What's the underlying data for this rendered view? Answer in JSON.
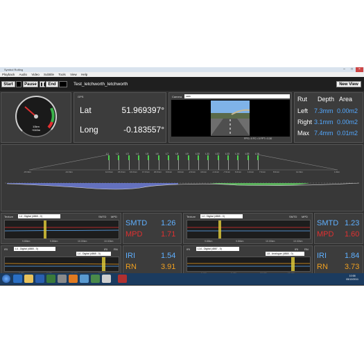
{
  "window": {
    "title": "Symbol Rutting"
  },
  "menu": [
    "Playback",
    "Audio",
    "Video",
    "Subtitle",
    "Tools",
    "View",
    "Help"
  ],
  "toolbar": {
    "start": "Start",
    "pause": "Pause",
    "end": "End",
    "session": "Test_letchworth_letchworth",
    "new_view": "New View"
  },
  "gps": {
    "label": "GPS",
    "lat_label": "Lat",
    "lat": "51.969397°",
    "long_label": "Long",
    "long": "-0.183557°"
  },
  "speed": {
    "readout": "10km\n+040m"
  },
  "camera": {
    "label": "Camera",
    "select": "cam",
    "stats": "FPS • 0 FC • 0 FPT • 0.30"
  },
  "rut": {
    "h_rut": "Rut",
    "h_depth": "Depth",
    "h_area": "Area",
    "rows": [
      {
        "label": "Left",
        "depth": "7.3mm",
        "area": "0.00m2"
      },
      {
        "label": "Right",
        "depth": "3.1mm",
        "area": "0.00m2"
      },
      {
        "label": "Max",
        "depth": "7.4mm",
        "area": "0.01m2"
      }
    ]
  },
  "profile": {
    "sensors": [
      "L1",
      "L2",
      "L3",
      "L4",
      "L5",
      "L6",
      "L7",
      "L8",
      "L9",
      "L10",
      "L11",
      "L12",
      "L13",
      "L14",
      "L15",
      "L16"
    ],
    "distance_labels": [
      "-15.0km",
      "-10.0km",
      "14.0mm",
      "15.0mm",
      "16.0mm",
      "17.0mm",
      "20.0mm",
      "0.0mm",
      "3.0mm",
      "-2.0mm",
      "4.0mm",
      "-1.0mm",
      "-7.0mm",
      "6.0mm",
      "1.0mm",
      "7.0mm",
      "8.0mm",
      "12.0km",
      "1.0km"
    ]
  },
  "texture_left": {
    "title": "Texture",
    "select": "L4 - Digital (4865 - 0)",
    "legend": [
      "SMTD",
      "MPD"
    ],
    "ticks": [
      "9.88km",
      "9.86km",
      "10.00km",
      "10.02km"
    ]
  },
  "texture_left_values": {
    "smtd_label": "SMTD",
    "smtd": "1.26",
    "mpd_label": "MPD",
    "mpd": "1.71"
  },
  "texture_right": {
    "title": "Texture",
    "select": "L4 - Digital (4865 - 0)",
    "legend": [
      "SMTD",
      "MPD"
    ],
    "ticks": [
      "9.88km",
      "9.86km",
      "10.00km",
      "10.02km"
    ]
  },
  "texture_right_values": {
    "smtd_label": "SMTD",
    "smtd": "1.23",
    "mpd_label": "MPD",
    "mpd": "1.60"
  },
  "iri_left": {
    "title": "IRI",
    "select": "L4 - Digital (4865 - 0)",
    "legend": [
      "IRI",
      "RN"
    ],
    "ticks": [
      "9.85km",
      "9.95km",
      "10.00km",
      "10.05km"
    ]
  },
  "iri_left_select2": "L4 - Digital (4865 - 0)",
  "iri_left_values": {
    "iri_label": "IRI",
    "iri": "1.54",
    "rn_label": "RN",
    "rn": "3.91"
  },
  "iri_right": {
    "title": "IRI",
    "select": "L14 - Digital (4867 - 0)",
    "legend": [
      "IRI",
      "RN"
    ],
    "ticks": [
      "9.90km",
      "9.95km",
      "10.00km",
      "10.05km"
    ]
  },
  "iri_right_select2": "L8 - Analogue (4865 - 0)",
  "iri_right_values": {
    "iri_label": "IRI",
    "iri": "1.84",
    "rn_label": "RN",
    "rn": "3.73"
  },
  "clock": {
    "time": "10:58",
    "date": "05/12/2011"
  },
  "colors": {
    "blue": "#5fb0ff",
    "red": "#e03030",
    "orange": "#f0a020",
    "white_text": "#ffffff"
  }
}
